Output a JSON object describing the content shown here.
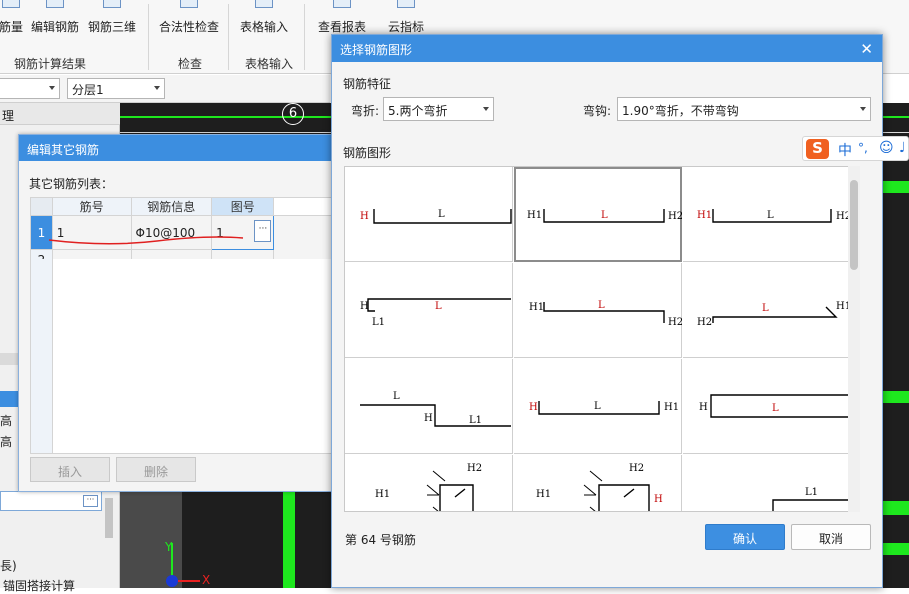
{
  "ribbon": {
    "buttons": [
      "筋量",
      "编辑钢筋",
      "钢筋三维",
      "合法性检查",
      "表格输入",
      "查看报表",
      "云指标"
    ],
    "groups": [
      "钢筋计算结果",
      "检查",
      "表格输入"
    ]
  },
  "toolbar2": {
    "layer_value": "分层1"
  },
  "canvas": {
    "axis_label": "6",
    "axis_x": "X",
    "axis_y": "Y"
  },
  "left_panel": {
    "fragments": [
      "理",
      "高",
      "高",
      "長)",
      "锚固搭接计算"
    ]
  },
  "edit_dialog": {
    "title": "编辑其它钢筋",
    "list_label": "其它钢筋列表：",
    "columns": [
      "筋号",
      "钢筋信息",
      "图号"
    ],
    "rows": [
      {
        "index": "1",
        "bar_no": "1",
        "info": "Φ10@100",
        "figure": "1"
      },
      {
        "index": "2",
        "bar_no": "",
        "info": "",
        "figure": ""
      }
    ],
    "insert_label": "插入",
    "delete_label": "删除"
  },
  "shape_dialog": {
    "title": "选择钢筋图形",
    "feature_label": "钢筋特征",
    "bend_label": "弯折:",
    "bend_value": "5.两个弯折",
    "hook_label": "弯钩:",
    "hook_value": "1.90°弯折，不带弯钩",
    "shape_label": "钢筋图形",
    "status": "第 64 号钢筋",
    "ok_label": "确认",
    "cancel_label": "取消",
    "shapes": {
      "r1c1": [
        "H",
        "L"
      ],
      "r1c2": [
        "H1",
        "L",
        "H2"
      ],
      "r1c3": [
        "H1",
        "L",
        "H2"
      ],
      "r2c1": [
        "H",
        "L",
        "L1"
      ],
      "r2c2": [
        "H1",
        "L",
        "H2"
      ],
      "r2c3": [
        "H2",
        "L",
        "H1"
      ],
      "r3c1": [
        "L",
        "H",
        "L1"
      ],
      "r3c2": [
        "H",
        "L",
        "H1"
      ],
      "r3c3": [
        "H",
        "L"
      ],
      "r4c1": [
        "H2",
        "H1"
      ],
      "r4c2": [
        "H2",
        "H1",
        "H"
      ],
      "r4c3": [
        "L1",
        "L2",
        "H"
      ]
    }
  },
  "ime": {
    "lang": "中",
    "punct": "°,"
  }
}
